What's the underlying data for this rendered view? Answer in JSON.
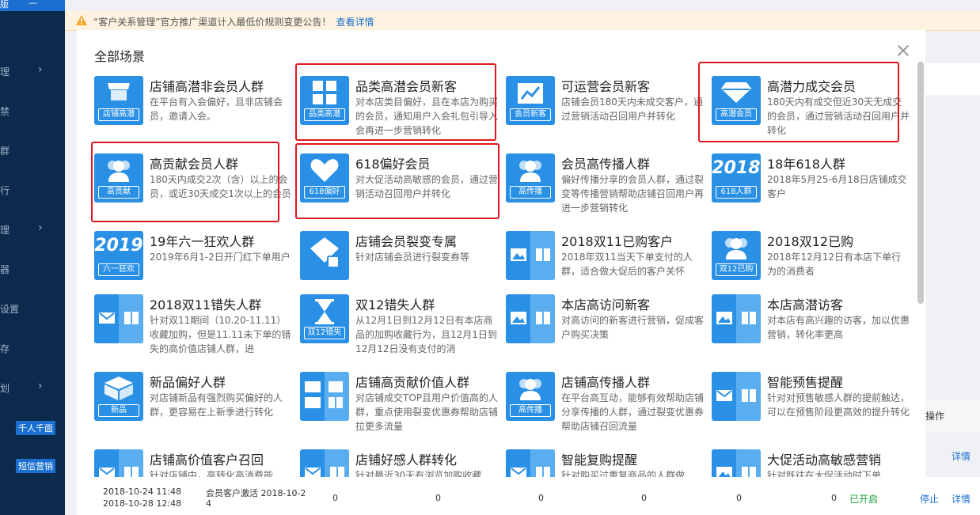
{
  "sidebar": {
    "top_left": "版",
    "top_right": "—",
    "frags": [
      "理",
      "禁",
      "群",
      "行",
      "理",
      "器",
      "设置",
      "存",
      "划"
    ],
    "badges": [
      "千人千面",
      "短信营销"
    ]
  },
  "notice": {
    "text": "“客户关系管理”官方推广渠道计入最低价规则变更公告！",
    "link": "查看详情"
  },
  "background": {
    "col_header": "操作",
    "link1": "详情",
    "row": {
      "dates": [
        "2018-10-24 11:48",
        "2018-10-28 12:48"
      ],
      "name": [
        "会员客户激活 2018-10-2",
        "4"
      ],
      "zeros": [
        "0",
        "0",
        "0",
        "0",
        "0",
        "0"
      ],
      "status": "已开启",
      "stop": "停止",
      "detail": "详情"
    }
  },
  "modal": {
    "title": "全部场景",
    "scenes": [
      {
        "title": "店铺高潜非会员人群",
        "desc": "在平台有入会偏好，且非店铺会员，邀请入会。",
        "icon": "store-icon",
        "label": "店铺高潜"
      },
      {
        "title": "品类高潜会员新客",
        "desc": "对本店类目偏好，且在本店为购买的会员，通知用户入会礼包引导入会再进一步营销转化",
        "icon": "grid-icon",
        "label": "品类高潜"
      },
      {
        "title": "可运营会员新客",
        "desc": "店铺会员180天内未成交客户，通过营销活动召回用户并转化",
        "icon": "chart-icon",
        "label": "会员新客"
      },
      {
        "title": "高潜力成交会员",
        "desc": "180天内有成交但近30天无成交的会员，通过营销活动召回用户并转化",
        "icon": "gem-icon",
        "label": "高潜会员"
      },
      {
        "title": "高贡献会员人群",
        "desc": "180天内成交2次（含）以上的会员，或近30天成交1次以上的会员",
        "icon": "people-icon",
        "label": "高贡献"
      },
      {
        "title": "618偏好会员",
        "desc": "对大促活动高敏感的会员，通过营销活动召回用户并转化",
        "icon": "heart-icon",
        "label": "618偏好"
      },
      {
        "title": "会员高传播人群",
        "desc": "偏好传播分享的会员人群，通过裂变等传播营销帮助店铺召回用户再进一步营销转化",
        "icon": "people-icon",
        "label": "高传播"
      },
      {
        "title": "18年618人群",
        "desc": "2018年5月25-6月18日店铺成交客户",
        "icon": "year-icon",
        "label": "618人群",
        "big": "2018"
      },
      {
        "title": "19年六一狂欢人群",
        "desc": "2019年6月1-2日开门红下单用户",
        "icon": "year-icon",
        "label": "六一狂欢",
        "big": "2019"
      },
      {
        "title": "店铺会员裂变专属",
        "desc": "针对店铺会员进行裂变券等",
        "icon": "fission-icon",
        "label": ""
      },
      {
        "title": "2018双11已购客户",
        "desc": "2018年双11当天下单支付的人群，适合做大促后的客户关怀",
        "icon": "image-book-icon",
        "label": ""
      },
      {
        "title": "2018双12已购",
        "desc": "2018年12月12日有本店下单行为的消费者",
        "icon": "people-icon",
        "label": "双12已购"
      },
      {
        "title": "2018双11错失人群",
        "desc": "针对双11期间（10.20-11.11）收藏加购，但是11.11未下单的错失的高价值店铺人群，进",
        "icon": "mail-book-icon",
        "label": ""
      },
      {
        "title": "双12错失人群",
        "desc": "从12月1日到12月12日有本店商品的加购收藏行为，且12月1日到12月12日没有支付的消",
        "icon": "hourglass-icon",
        "label": "双12错失"
      },
      {
        "title": "本店高访问新客",
        "desc": "对高访问的新客进行营销，促成客户购买决策",
        "icon": "image-book-icon",
        "label": ""
      },
      {
        "title": "本店高潜访客",
        "desc": "对本店有高兴趣的访客，加以优惠营销，转化率更高",
        "icon": "image-book-icon",
        "label": ""
      },
      {
        "title": "新品偏好人群",
        "desc": "对店铺新品有强烈购买偏好的人群，更容易在上新季进行转化",
        "icon": "box-icon",
        "label": "新品"
      },
      {
        "title": "店铺高贡献价值人群",
        "desc": "对店铺成交TOP且用户价值高的人群，重点使用裂变优惠券帮助店铺拉更多流量",
        "icon": "multi-icon",
        "label": ""
      },
      {
        "title": "店铺高传播人群",
        "desc": "在平台高互动，能够有效帮助店铺分享传播的人群，通过裂变优惠券帮助店铺召回流量",
        "icon": "people-icon",
        "label": "高传播"
      },
      {
        "title": "智能预售提醒",
        "desc": "针对对预售敏感人群的提前触达，可以在预售阶段更高效的提升转化",
        "icon": "mail-book-icon",
        "label": ""
      },
      {
        "title": "店铺高价值客户召回",
        "desc": "针对店铺中，高转化高消费能",
        "icon": "mail-book-icon",
        "label": ""
      },
      {
        "title": "店铺好感人群转化",
        "desc": "针对最近30天有浏览加购收藏",
        "icon": "mail-book-icon",
        "label": ""
      },
      {
        "title": "智能复购提醒",
        "desc": "针对购买过重复商品的人群做",
        "icon": "mail-book-icon",
        "label": ""
      },
      {
        "title": "大促活动高敏感营销",
        "desc": "针对既往在大促活动时下单",
        "icon": "image-book-icon",
        "label": ""
      }
    ]
  },
  "colors": {
    "accent": "#2990e5",
    "highlight": "#e0161f",
    "sidebar": "#0c2a4b"
  }
}
